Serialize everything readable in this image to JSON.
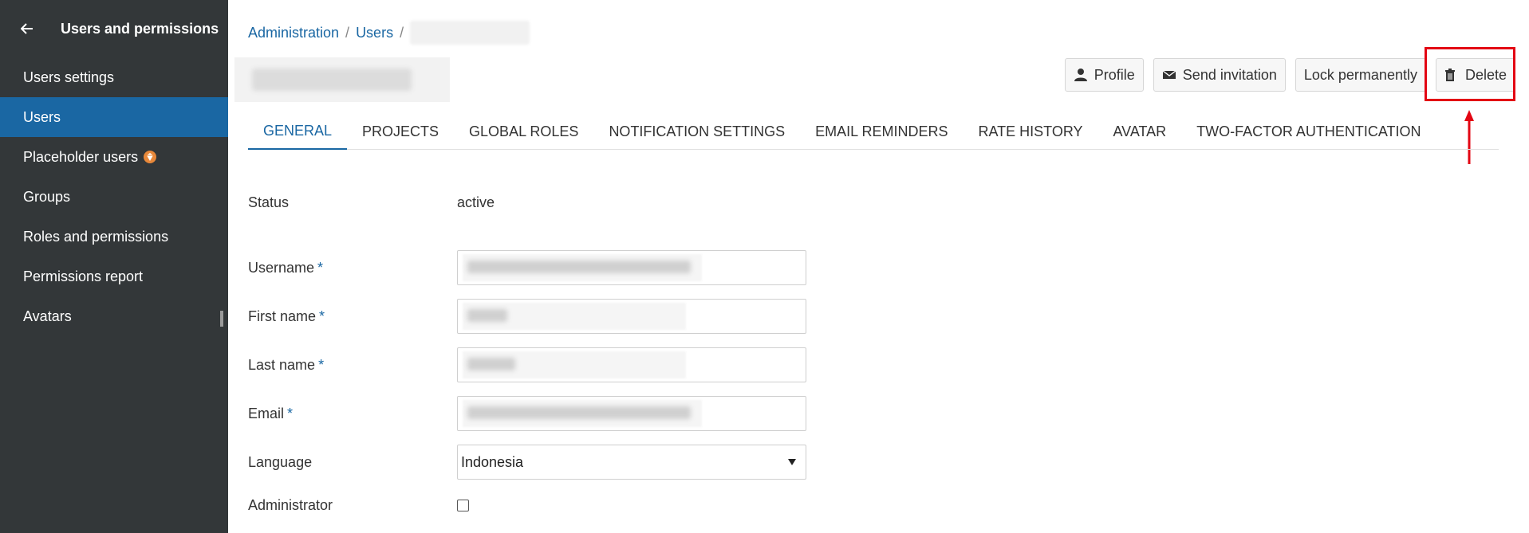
{
  "sidebar": {
    "title": "Users and permissions",
    "items": [
      {
        "label": "Users settings",
        "active": false
      },
      {
        "label": "Users",
        "active": true
      },
      {
        "label": "Placeholder users",
        "active": false,
        "badge": "enterprise-icon"
      },
      {
        "label": "Groups",
        "active": false
      },
      {
        "label": "Roles and permissions",
        "active": false
      },
      {
        "label": "Permissions report",
        "active": false
      },
      {
        "label": "Avatars",
        "active": false
      }
    ]
  },
  "breadcrumb": {
    "items": [
      "Administration",
      "Users"
    ],
    "separator": "/"
  },
  "toolbar": {
    "profile": "Profile",
    "send_invitation": "Send invitation",
    "lock_permanently": "Lock permanently",
    "delete": "Delete"
  },
  "tabs": [
    {
      "label": "GENERAL",
      "active": true
    },
    {
      "label": "PROJECTS",
      "active": false
    },
    {
      "label": "GLOBAL ROLES",
      "active": false
    },
    {
      "label": "NOTIFICATION SETTINGS",
      "active": false
    },
    {
      "label": "EMAIL REMINDERS",
      "active": false
    },
    {
      "label": "RATE HISTORY",
      "active": false
    },
    {
      "label": "AVATAR",
      "active": false
    },
    {
      "label": "TWO-FACTOR AUTHENTICATION",
      "active": false
    }
  ],
  "form": {
    "status_label": "Status",
    "status_value": "active",
    "username_label": "Username",
    "first_name_label": "First name",
    "last_name_label": "Last name",
    "email_label": "Email",
    "language_label": "Language",
    "language_value": "Indonesia",
    "administrator_label": "Administrator",
    "required_mark": "*"
  },
  "colors": {
    "sidebar_bg": "#333739",
    "active_item": "#1a67a3",
    "link": "#1a67a3",
    "highlight": "#e30613"
  }
}
